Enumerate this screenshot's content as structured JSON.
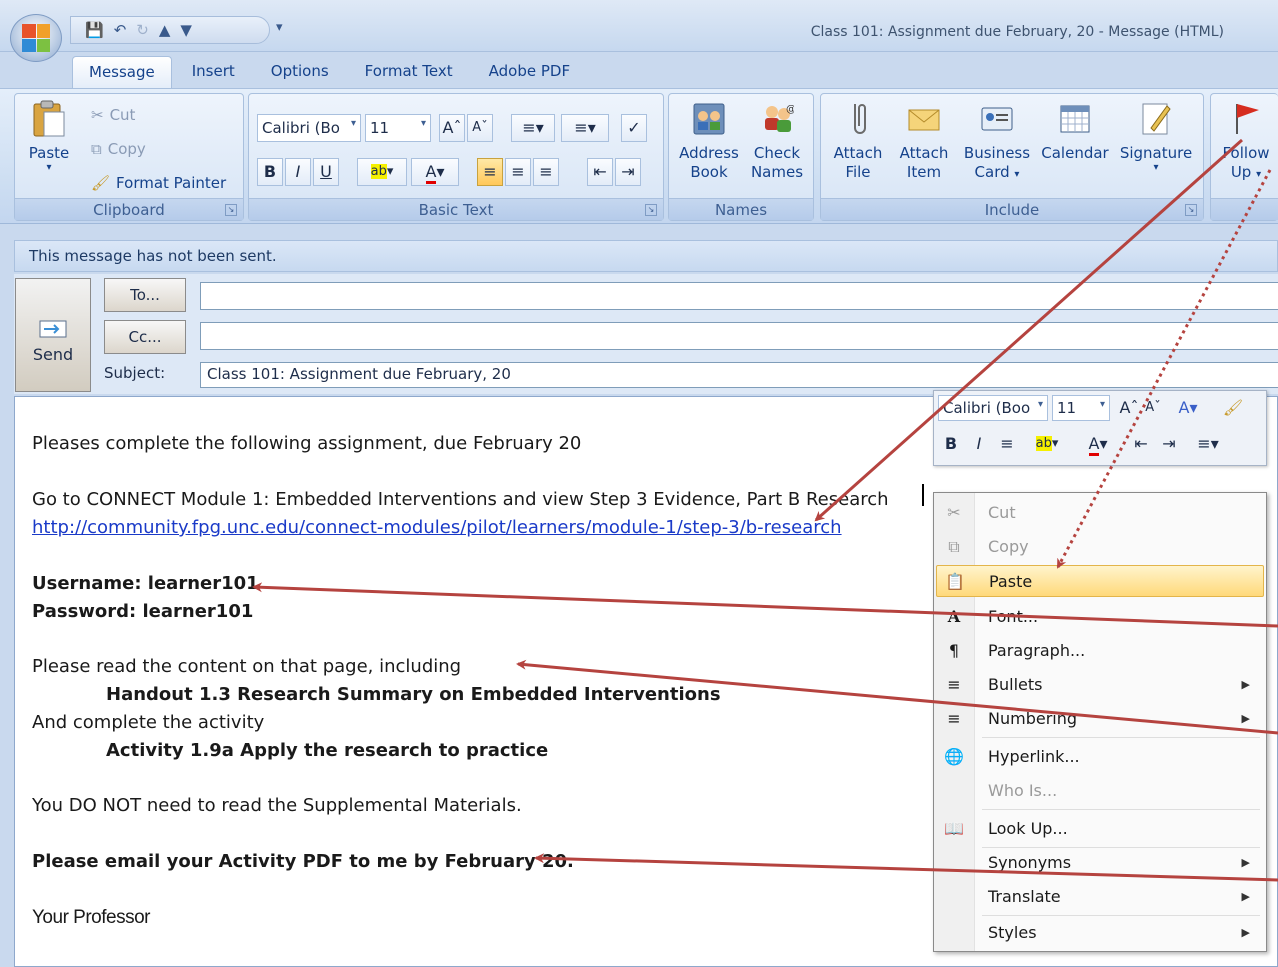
{
  "window": {
    "title": "Class 101: Assignment due February, 20 - Message (HTML)"
  },
  "tabs": [
    {
      "label": "Message"
    },
    {
      "label": "Insert"
    },
    {
      "label": "Options"
    },
    {
      "label": "Format Text"
    },
    {
      "label": "Adobe PDF"
    }
  ],
  "ribbon": {
    "clipboard": {
      "label": "Clipboard",
      "paste": "Paste",
      "cut": "Cut",
      "copy": "Copy",
      "format_painter": "Format Painter"
    },
    "basic_text": {
      "label": "Basic Text",
      "font": "Calibri (Bo",
      "size": "11",
      "bold": "B",
      "italic": "I",
      "underline": "U",
      "font_color": "A"
    },
    "names": {
      "label": "Names",
      "address_book_1": "Address",
      "address_book_2": "Book",
      "check_names_1": "Check",
      "check_names_2": "Names"
    },
    "include": {
      "label": "Include",
      "attach_file_1": "Attach",
      "attach_file_2": "File",
      "attach_item_1": "Attach",
      "attach_item_2": "Item",
      "business_card_1": "Business",
      "business_card_2": "Card",
      "calendar": "Calendar",
      "signature": "Signature"
    },
    "follow_up": {
      "line1": "Follow",
      "line2": "Up"
    }
  },
  "notice": "This message has not been sent.",
  "header": {
    "send": "Send",
    "to_btn": "To...",
    "cc_btn": "Cc...",
    "to_value": "",
    "cc_value": "",
    "subject_label": "Subject:",
    "subject_value": "Class 101: Assignment due February, 20"
  },
  "body": {
    "line1": "Pleases complete the following assignment, due February 20",
    "line2": "Go to CONNECT Module 1: Embedded Interventions and view Step 3 Evidence, Part B Research",
    "link": "http://community.fpg.unc.edu/connect-modules/pilot/learners/module-1/step-3/b-research",
    "username": "Username:  learner101",
    "password": "Password:  learner101",
    "line5": "Please read the content on that page, including",
    "handout": "Handout 1.3 Research Summary on Embedded Interventions",
    "line7": "And complete the activity",
    "activity": "Activity 1.9a Apply the research to practice",
    "line9": "You DO NOT need to read the Supplemental Materials.",
    "line10": "Please email your Activity PDF to me by February 20.",
    "signature": "Your Professor"
  },
  "mini_toolbar": {
    "font": "Calibri (Boo",
    "size": "11",
    "bold": "B",
    "italic": "I",
    "font_color": "A"
  },
  "context_menu": [
    {
      "label": "Cut",
      "icon": "scissors-icon",
      "disabled": true
    },
    {
      "label": "Copy",
      "icon": "copy-icon",
      "disabled": true
    },
    {
      "label": "Paste",
      "icon": "paste-icon",
      "highlighted": true
    },
    {
      "label": "Font...",
      "icon": "font-icon"
    },
    {
      "label": "Paragraph...",
      "icon": "paragraph-icon"
    },
    {
      "label": "Bullets",
      "icon": "bullets-icon",
      "submenu": true
    },
    {
      "label": "Numbering",
      "icon": "numbering-icon",
      "submenu": true
    },
    {
      "label": "Hyperlink...",
      "icon": "hyperlink-icon"
    },
    {
      "label": "Who Is...",
      "icon": "",
      "disabled": true
    },
    {
      "label": "Look Up...",
      "icon": "lookup-icon"
    },
    {
      "label": "Synonyms",
      "icon": "",
      "submenu": true
    },
    {
      "label": "Translate",
      "icon": "",
      "submenu": true
    },
    {
      "label": "Styles",
      "icon": "",
      "submenu": true
    }
  ],
  "colors": {
    "annotation_arrow": "#b5433f",
    "highlight": "#ffd97a",
    "link": "#1a3ac8"
  }
}
